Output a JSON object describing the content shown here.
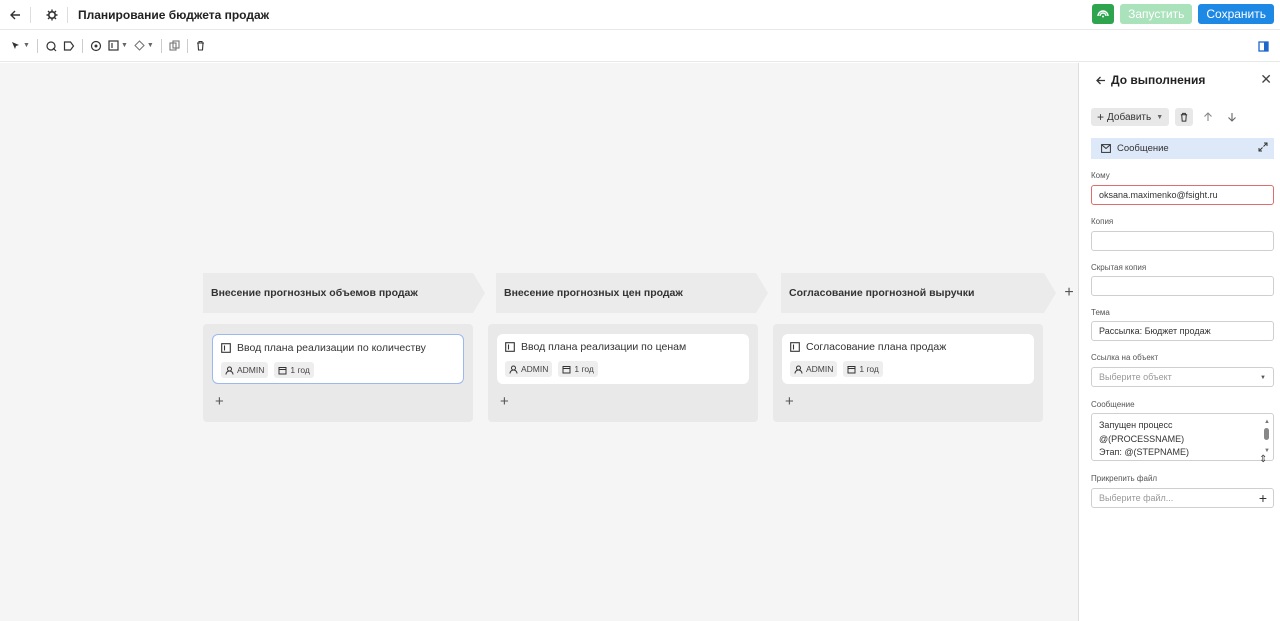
{
  "header": {
    "title": "Планирование бюджета продаж",
    "run_label": "Запустить",
    "save_label": "Сохранить"
  },
  "stages": [
    {
      "title": "Внесение прогнозных объемов продаж",
      "card": {
        "title": "Ввод плана реализации по количеству",
        "user": "ADMIN",
        "period": "1 год"
      }
    },
    {
      "title": "Внесение прогнозных цен продаж",
      "card": {
        "title": "Ввод плана реализации по ценам",
        "user": "ADMIN",
        "period": "1 год"
      }
    },
    {
      "title": "Согласование прогнозной выручки",
      "card": {
        "title": "Согласование плана продаж",
        "user": "ADMIN",
        "period": "1 год"
      }
    }
  ],
  "panel": {
    "title": "До выполнения",
    "add_label": "Добавить",
    "tab_label": "Сообщение",
    "to_label": "Кому",
    "to_value": "oksana.maximenko@fsight.ru",
    "cc_label": "Копия",
    "bcc_label": "Скрытая копия",
    "subject_label": "Тема",
    "subject_value": "Рассылка: Бюджет продаж",
    "link_label": "Ссылка на объект",
    "link_placeholder": "Выберите объект",
    "message_label": "Сообщение",
    "message_lines": [
      "Запущен процесс",
      "@(PROCESSNAME)",
      "Этап:  @(STEPNAME)"
    ],
    "attach_label": "Прикрепить файл",
    "attach_placeholder": "Выберите файл..."
  },
  "colors": {
    "accent": "#1e88e5",
    "success": "#2ea44f",
    "selected_tab": "#dde8f8"
  }
}
